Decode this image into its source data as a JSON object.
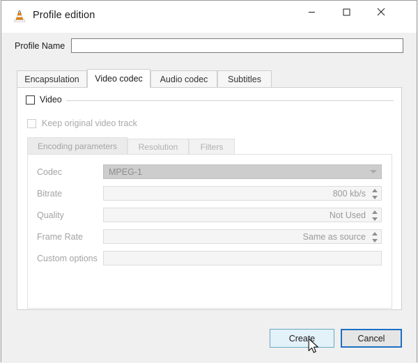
{
  "window": {
    "title": "Profile edition",
    "app_icon": "vlc-cone-icon",
    "controls": {
      "minimize": "minimize-icon",
      "maximize": "maximize-icon",
      "close": "close-icon"
    }
  },
  "profile": {
    "label": "Profile Name",
    "value": "",
    "placeholder": ""
  },
  "tabs": [
    {
      "label": "Encapsulation",
      "selected": false
    },
    {
      "label": "Video codec",
      "selected": true
    },
    {
      "label": "Audio codec",
      "selected": false
    },
    {
      "label": "Subtitles",
      "selected": false
    }
  ],
  "video_group": {
    "label": "Video",
    "checked": false,
    "enabled": true,
    "keep_original": {
      "label": "Keep original video track",
      "checked": false,
      "enabled": false
    }
  },
  "inner_tabs": [
    {
      "label": "Encoding parameters",
      "selected": true
    },
    {
      "label": "Resolution",
      "selected": false
    },
    {
      "label": "Filters",
      "selected": false
    }
  ],
  "encoding": {
    "codec": {
      "label": "Codec",
      "value": "MPEG-1",
      "type": "combobox",
      "enabled": false
    },
    "bitrate": {
      "label": "Bitrate",
      "value": "800 kb/s",
      "type": "spinbox",
      "enabled": false
    },
    "quality": {
      "label": "Quality",
      "value": "Not Used",
      "type": "spinbox",
      "enabled": false
    },
    "frame_rate": {
      "label": "Frame Rate",
      "value": "Same as source",
      "type": "spinbox",
      "enabled": false
    },
    "custom_options": {
      "label": "Custom options",
      "value": "",
      "type": "lineedit",
      "enabled": false
    }
  },
  "footer": {
    "create_label": "Create",
    "cancel_label": "Cancel"
  },
  "colors": {
    "accent_focus": "#1a6fc4",
    "hover_fill": "#e3f1f9",
    "hover_border": "#69a8c4",
    "disabled_text": "#a3a3a3",
    "window_bg": "#f0f0f0",
    "panel_bg": "#ffffff",
    "vlc_orange": "#e8820c"
  }
}
